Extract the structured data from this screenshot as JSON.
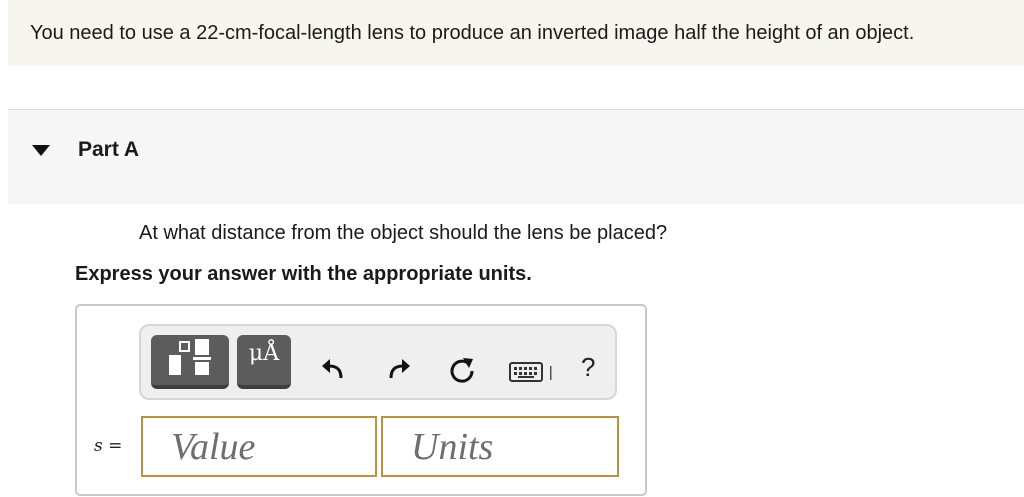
{
  "problem": {
    "text": "You need to use a 22-cm-focal-length lens to produce an inverted image half the height of an object."
  },
  "part": {
    "title": "Part A",
    "question": "At what distance from the object should the lens be placed?",
    "instruction": "Express your answer with the appropriate units."
  },
  "answer": {
    "variable": "s",
    "equals": "=",
    "value_placeholder": "Value",
    "units_placeholder": "Units"
  },
  "toolbar": {
    "units_button_label": "μÅ",
    "help_label": "?",
    "icons": [
      "templates-icon",
      "units-icon",
      "undo-icon",
      "redo-icon",
      "reset-icon",
      "keyboard-icon",
      "help-icon"
    ]
  },
  "colors": {
    "problem_bg": "#f7f6ee",
    "part_header_bg": "#f6f6f6",
    "field_border": "#b89144",
    "tool_button_bg": "#5c5c5c"
  }
}
